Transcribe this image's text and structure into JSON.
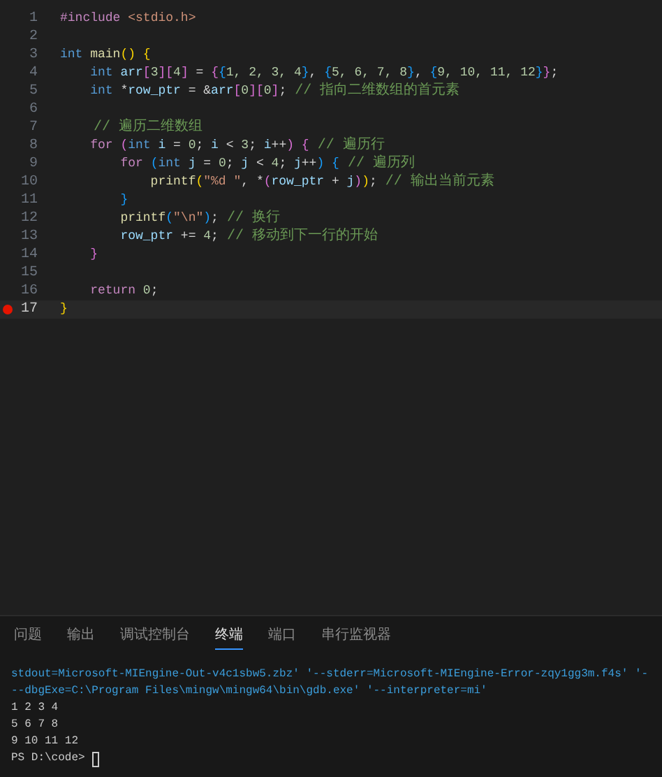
{
  "editor": {
    "lines": [
      {
        "number": "1",
        "current": false,
        "breakpoint": false,
        "tokens": [
          {
            "kind": "ctrl",
            "text": "#include"
          },
          {
            "kind": "str",
            "text": " <stdio.h>"
          }
        ]
      },
      {
        "number": "2",
        "current": false,
        "breakpoint": false
      },
      {
        "number": "3",
        "current": false,
        "breakpoint": false,
        "tokens": [
          {
            "kind": "kw",
            "text": "int"
          },
          {
            "kind": "fn",
            "text": " main"
          },
          {
            "kind": "b1",
            "text": "()"
          },
          {
            "kind": "b1",
            "text": " {"
          }
        ]
      },
      {
        "number": "4",
        "current": false,
        "breakpoint": false,
        "tokens": [
          {
            "kind": "kw",
            "text": "    int"
          },
          {
            "kind": "var",
            "text": " arr"
          },
          {
            "kind": "b2",
            "text": "["
          },
          {
            "kind": "num",
            "text": "3"
          },
          {
            "kind": "b2",
            "text": "]["
          },
          {
            "kind": "num",
            "text": "4"
          },
          {
            "kind": "b2",
            "text": "]"
          },
          {
            "kind": "p",
            "text": " = "
          },
          {
            "kind": "b2",
            "text": "{"
          },
          {
            "kind": "b3",
            "text": "{"
          },
          {
            "kind": "num",
            "text": "1, 2, 3, 4"
          },
          {
            "kind": "b3",
            "text": "}"
          },
          {
            "kind": "p",
            "text": ", "
          },
          {
            "kind": "b3",
            "text": "{"
          },
          {
            "kind": "num",
            "text": "5, 6, 7, 8"
          },
          {
            "kind": "b3",
            "text": "}"
          },
          {
            "kind": "p",
            "text": ", "
          },
          {
            "kind": "b3",
            "text": "{"
          },
          {
            "kind": "num",
            "text": "9, 10, 11, 12"
          },
          {
            "kind": "b3",
            "text": "}"
          },
          {
            "kind": "b2",
            "text": "}"
          },
          {
            "kind": "p",
            "text": ";"
          }
        ]
      },
      {
        "number": "5",
        "current": false,
        "breakpoint": false,
        "tokens": [
          {
            "kind": "kw",
            "text": "    int"
          },
          {
            "kind": "p",
            "text": " *"
          },
          {
            "kind": "var",
            "text": "row_ptr"
          },
          {
            "kind": "p",
            "text": " = &"
          },
          {
            "kind": "var",
            "text": "arr"
          },
          {
            "kind": "b2",
            "text": "["
          },
          {
            "kind": "num",
            "text": "0"
          },
          {
            "kind": "b2",
            "text": "]["
          },
          {
            "kind": "num",
            "text": "0"
          },
          {
            "kind": "b2",
            "text": "]"
          },
          {
            "kind": "p",
            "text": ";"
          },
          {
            "kind": "cmt",
            "text": " // 指向二维数组的首元素"
          }
        ]
      },
      {
        "number": "6",
        "current": false,
        "breakpoint": false
      },
      {
        "number": "7",
        "current": false,
        "breakpoint": false,
        "tokens": [
          {
            "kind": "cmt",
            "text": "    // 遍历二维数组"
          }
        ]
      },
      {
        "number": "8",
        "current": false,
        "breakpoint": false,
        "tokens": [
          {
            "kind": "ctrl",
            "text": "    for"
          },
          {
            "kind": "b2",
            "text": " ("
          },
          {
            "kind": "kw",
            "text": "int"
          },
          {
            "kind": "var",
            "text": " i"
          },
          {
            "kind": "p",
            "text": " = "
          },
          {
            "kind": "num",
            "text": "0"
          },
          {
            "kind": "p",
            "text": ";"
          },
          {
            "kind": "var",
            "text": " i"
          },
          {
            "kind": "p",
            "text": " < "
          },
          {
            "kind": "num",
            "text": "3"
          },
          {
            "kind": "p",
            "text": ";"
          },
          {
            "kind": "var",
            "text": " i"
          },
          {
            "kind": "p",
            "text": "++"
          },
          {
            "kind": "b2",
            "text": ")"
          },
          {
            "kind": "b2",
            "text": " {"
          },
          {
            "kind": "cmt",
            "text": " // 遍历行"
          }
        ]
      },
      {
        "number": "9",
        "current": false,
        "breakpoint": false,
        "tokens": [
          {
            "kind": "ctrl",
            "text": "        for"
          },
          {
            "kind": "b3",
            "text": " ("
          },
          {
            "kind": "kw",
            "text": "int"
          },
          {
            "kind": "var",
            "text": " j"
          },
          {
            "kind": "p",
            "text": " = "
          },
          {
            "kind": "num",
            "text": "0"
          },
          {
            "kind": "p",
            "text": ";"
          },
          {
            "kind": "var",
            "text": " j"
          },
          {
            "kind": "p",
            "text": " < "
          },
          {
            "kind": "num",
            "text": "4"
          },
          {
            "kind": "p",
            "text": ";"
          },
          {
            "kind": "var",
            "text": " j"
          },
          {
            "kind": "p",
            "text": "++"
          },
          {
            "kind": "b3",
            "text": ")"
          },
          {
            "kind": "b3",
            "text": " {"
          },
          {
            "kind": "cmt",
            "text": " // 遍历列"
          }
        ]
      },
      {
        "number": "10",
        "current": false,
        "breakpoint": false,
        "tokens": [
          {
            "kind": "fn",
            "text": "            printf"
          },
          {
            "kind": "b1",
            "text": "("
          },
          {
            "kind": "str",
            "text": "\"%d \""
          },
          {
            "kind": "p",
            "text": ", *"
          },
          {
            "kind": "b2",
            "text": "("
          },
          {
            "kind": "var",
            "text": "row_ptr"
          },
          {
            "kind": "p",
            "text": " + "
          },
          {
            "kind": "var",
            "text": "j"
          },
          {
            "kind": "b2",
            "text": ")"
          },
          {
            "kind": "b1",
            "text": ")"
          },
          {
            "kind": "p",
            "text": ";"
          },
          {
            "kind": "cmt",
            "text": " // 输出当前元素"
          }
        ]
      },
      {
        "number": "11",
        "current": false,
        "breakpoint": false,
        "tokens": [
          {
            "kind": "b3",
            "text": "        }"
          }
        ]
      },
      {
        "number": "12",
        "current": false,
        "breakpoint": false,
        "tokens": [
          {
            "kind": "fn",
            "text": "        printf"
          },
          {
            "kind": "b3",
            "text": "("
          },
          {
            "kind": "str",
            "text": "\"\\n\""
          },
          {
            "kind": "b3",
            "text": ")"
          },
          {
            "kind": "p",
            "text": ";"
          },
          {
            "kind": "cmt",
            "text": " // 换行"
          }
        ]
      },
      {
        "number": "13",
        "current": false,
        "breakpoint": false,
        "tokens": [
          {
            "kind": "var",
            "text": "        row_ptr"
          },
          {
            "kind": "p",
            "text": " += "
          },
          {
            "kind": "num",
            "text": "4"
          },
          {
            "kind": "p",
            "text": ";"
          },
          {
            "kind": "cmt",
            "text": " // 移动到下一行的开始"
          }
        ]
      },
      {
        "number": "14",
        "current": false,
        "breakpoint": false,
        "tokens": [
          {
            "kind": "b2",
            "text": "    }"
          }
        ]
      },
      {
        "number": "15",
        "current": false,
        "breakpoint": false
      },
      {
        "number": "16",
        "current": false,
        "breakpoint": false,
        "tokens": [
          {
            "kind": "ctrl",
            "text": "    return"
          },
          {
            "kind": "num",
            "text": " 0"
          },
          {
            "kind": "p",
            "text": ";"
          }
        ]
      },
      {
        "number": "17",
        "current": true,
        "breakpoint": true,
        "tokens": [
          {
            "kind": "b1",
            "text": "}"
          }
        ]
      }
    ]
  },
  "panel": {
    "tabs": [
      {
        "label": "问题",
        "selected": false
      },
      {
        "label": "输出",
        "selected": false
      },
      {
        "label": "调试控制台",
        "selected": false
      },
      {
        "label": "终端",
        "selected": true
      },
      {
        "label": "端口",
        "selected": false
      },
      {
        "label": "串行监视器",
        "selected": false
      }
    ],
    "terminal": [
      {
        "kind": "cmd",
        "text": "stdout=Microsoft-MIEngine-Out-v4c1sbw5.zbz' '--stderr=Microsoft-MIEngine-Error-zqy1gg3m.f4s' '-"
      },
      {
        "kind": "cmd",
        "text": "--dbgExe=C:\\Program Files\\mingw\\mingw64\\bin\\gdb.exe' '--interpreter=mi'"
      },
      {
        "kind": "out",
        "text": "1 2 3 4"
      },
      {
        "kind": "out",
        "text": "5 6 7 8"
      },
      {
        "kind": "out",
        "text": "9 10 11 12"
      }
    ],
    "prompt": "PS D:\\code>"
  }
}
